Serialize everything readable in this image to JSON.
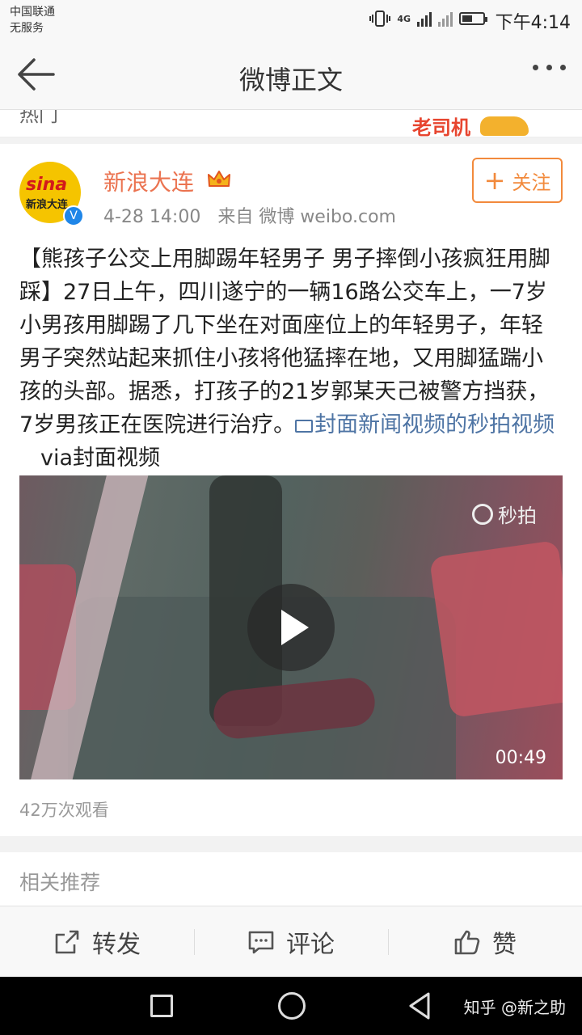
{
  "status_bar": {
    "carrier_line1": "中国联通",
    "carrier_line2": "无服务",
    "network": "4G",
    "time": "下午4:14",
    "battery_level": 0.5
  },
  "nav": {
    "back_icon": "arrow-left-icon",
    "title": "微博正文",
    "more_icon": "more-dots-icon"
  },
  "top_strip": {
    "text": "热门",
    "banner_label": "老司机"
  },
  "post": {
    "author": "新浪大连",
    "avatar_logo": "sina",
    "avatar_text": "新浪大连",
    "verified_mark": "V",
    "time": "4-28 14:00",
    "source": "来自 微博 weibo.com",
    "follow_label": "关注",
    "follow_plus": "+",
    "body": "【熊孩子公交上用脚踢年轻男子  男子摔倒小孩疯狂用脚踩】27日上午，四川遂宁的一辆16路公交车上，一7岁小男孩用脚踢了几下坐在对面座位上的年轻男子，年轻男子突然站起来抓住小孩将他猛摔在地，又用脚猛踹小孩的头部。据悉，打孩子的21岁郭某天己被警方挡获，7岁男孩正在医院进行治疗。",
    "video_link": "封面新闻视频的秒拍视频",
    "via": "via封面视频",
    "video": {
      "watermark": "秒拍",
      "duration": "00:49"
    },
    "views": "42万次观看"
  },
  "related_title": "相关推荐",
  "actions": {
    "repost_label": "转发",
    "comment_label": "评论",
    "like_label": "赞"
  },
  "system_nav": {
    "watermark": "知乎 @新之助"
  },
  "colors": {
    "accent": "#eb7350",
    "follow": "#f28a3c",
    "link": "#4e74a4",
    "verified": "#1f86e8"
  }
}
